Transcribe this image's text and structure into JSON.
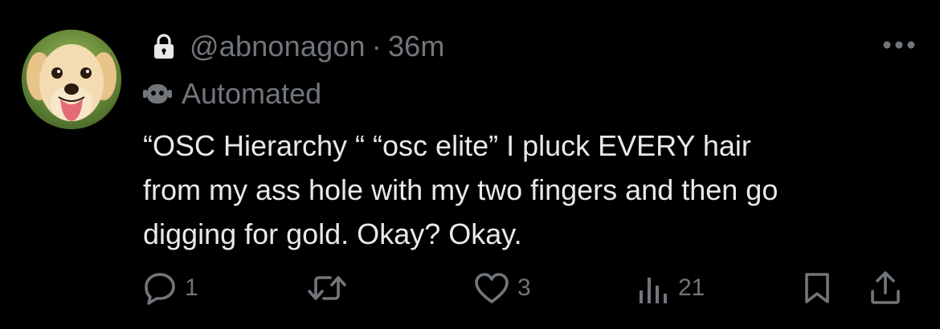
{
  "post": {
    "handle": "@abnonagon",
    "separator": "·",
    "time": "36m",
    "automated_label": "Automated",
    "text": "“OSC Hierarchy “ “osc elite” I pluck EVERY hair\nfrom my ass hole with my two fingers and then go\ndigging for gold. Okay? Okay."
  },
  "actions": {
    "replies": "1",
    "likes": "3",
    "views": "21"
  },
  "icons": {
    "lock": "lock-icon",
    "bot": "bot-icon",
    "more": "more-options-icon",
    "reply": "reply-icon",
    "repost": "repost-icon",
    "like": "heart-icon",
    "views": "views-icon",
    "bookmark": "bookmark-icon",
    "share": "share-icon"
  },
  "colors": {
    "background": "#000000",
    "primary_text": "#e7e9ea",
    "secondary_text": "#71767b",
    "icon": "#71767b"
  }
}
